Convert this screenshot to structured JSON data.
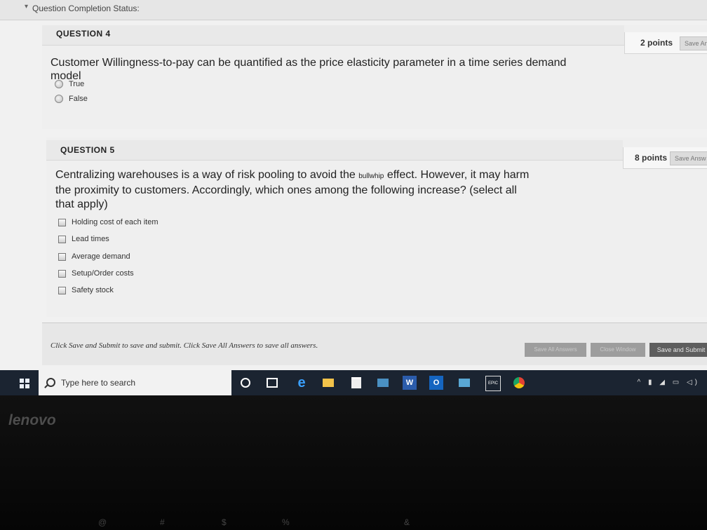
{
  "status_bar": {
    "caret": "▾",
    "label": "Question Completion Status:"
  },
  "q4": {
    "title": "QUESTION 4",
    "points": "2 points",
    "save": "Save Ans",
    "text_line1": "Customer Willingness-to-pay can be quantified as the price elasticity parameter in a time series demand",
    "text_line2": "model",
    "options": [
      "True",
      "False"
    ]
  },
  "q5": {
    "title": "QUESTION 5",
    "points": "8 points",
    "save": "Save Answ",
    "text_part1": "Centralizing warehouses is a way of risk pooling to avoid the ",
    "text_small": "bullwhip",
    "text_part2": " effect. However, it may harm",
    "text_line2": "the proximity to customers. Accordingly, which ones among the following increase? (select all",
    "text_line3": "that apply)",
    "options": [
      "Holding cost of each item",
      "Lead times",
      "Average demand",
      "Setup/Order costs",
      "Safety stock"
    ]
  },
  "footer": {
    "text": "Click Save and Submit to save and submit. Click Save All Answers to save all answers.",
    "save_all": "Save All Answers",
    "close": "Close Window",
    "submit": "Save and Submit"
  },
  "taskbar": {
    "search_placeholder": "Type here to search",
    "epic": "EPIC",
    "word": "W",
    "outlook": "O"
  },
  "bezel": {
    "logo": "lenovo",
    "keys": [
      "@",
      "#",
      "$",
      "%",
      "&"
    ]
  },
  "colors": {
    "taskbar": "#1b2431",
    "submit_button": "#5e5e5e"
  }
}
